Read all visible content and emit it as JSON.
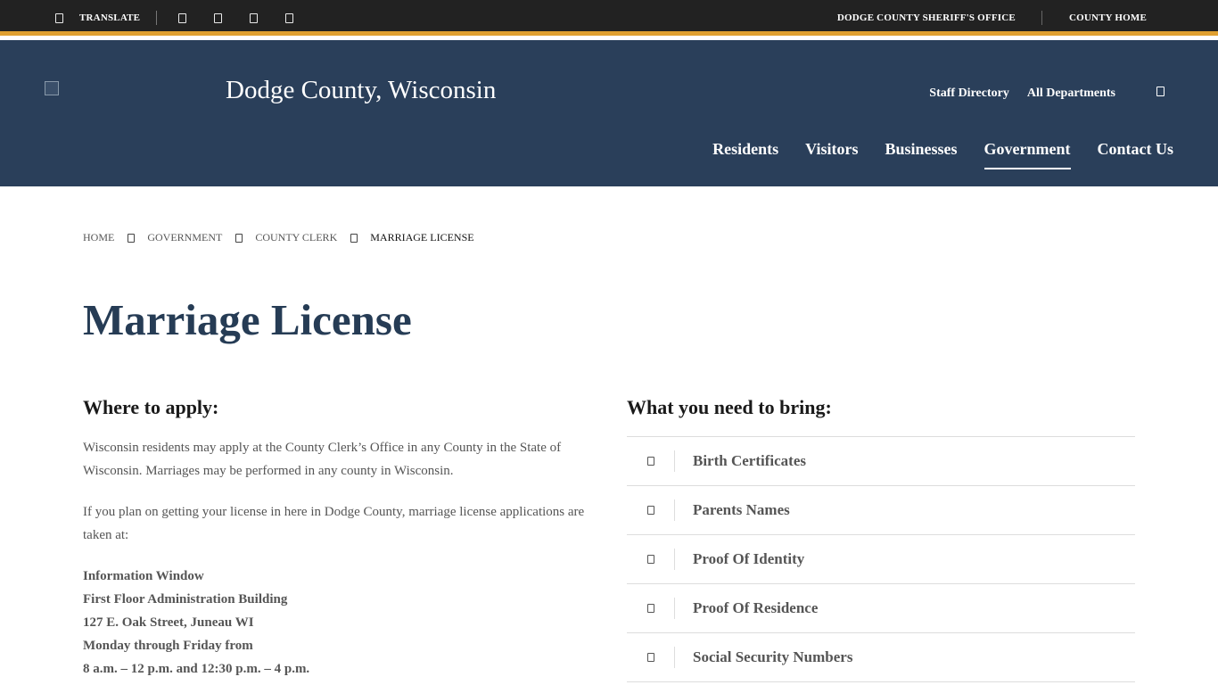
{
  "topbar": {
    "translate_label": "TRANSLATE",
    "social_icons": [
      "facebook-icon",
      "twitter-icon",
      "youtube-icon",
      "instagram-icon"
    ],
    "links": [
      "DODGE COUNTY SHERIFF'S OFFICE",
      "COUNTY HOME"
    ],
    "accent_color": "#e0a030",
    "background_color": "#222222"
  },
  "header": {
    "background_color": "#2a3f5a",
    "site_title": "Dodge County, Wisconsin",
    "util_links": [
      "Staff Directory",
      "All Departments"
    ],
    "nav": [
      {
        "label": "Residents",
        "active": false
      },
      {
        "label": "Visitors",
        "active": false
      },
      {
        "label": "Businesses",
        "active": false
      },
      {
        "label": "Government",
        "active": true
      },
      {
        "label": "Contact Us",
        "active": false
      }
    ]
  },
  "breadcrumb": [
    "HOME",
    "GOVERNMENT",
    "COUNTY CLERK",
    "MARRIAGE LICENSE"
  ],
  "main": {
    "title": "Marriage License",
    "title_color": "#263c55",
    "left": {
      "heading": "Where to apply:",
      "paragraphs": [
        "Wisconsin residents may apply at the County Clerk’s Office in any County in the State of Wisconsin.  Marriages may be performed in any county in Wisconsin.",
        "If you plan on getting your license in here in Dodge County, marriage license applications are taken at:"
      ],
      "address_lines": [
        "Information Window",
        "First Floor Administration Building",
        "127 E. Oak Street, Juneau WI",
        "Monday through Friday from",
        "8 a.m. – 12 p.m. and 12:30 p.m. – 4 p.m."
      ]
    },
    "right": {
      "heading": "What you need to bring:",
      "items": [
        "Birth Certificates",
        "Parents Names",
        "Proof Of Identity",
        "Proof Of Residence",
        "Social Security Numbers"
      ]
    }
  }
}
